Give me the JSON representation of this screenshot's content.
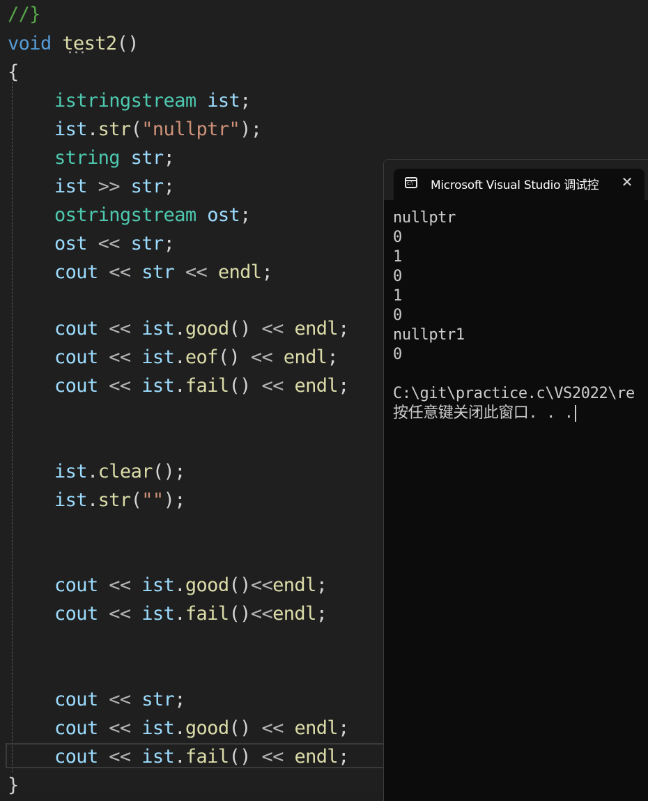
{
  "editor": {
    "lines": {
      "comment_close": "//}",
      "fn_decl_kw": "void",
      "fn_decl_name": "test2",
      "fn_decl_parens": "()",
      "open_brace": "{",
      "close_brace": "}",
      "l1_type": "istringstream",
      "l1_var": "ist",
      "l2_obj": "ist",
      "l2_fn": "str",
      "l2_str": "\"nullptr\"",
      "l3_type": "string",
      "l3_var": "str",
      "l4_a": "ist",
      "l4_op": ">>",
      "l4_b": "str",
      "l5_type": "ostringstream",
      "l5_var": "ost",
      "l6_a": "ost",
      "l6_op": "<<",
      "l6_b": "str",
      "cout": "cout",
      "endl": "endl",
      "op_out": "<<",
      "ist": "ist",
      "str": "str",
      "good": "good",
      "eof": "eof",
      "fail": "fail",
      "clear": "clear",
      "empty_str": "\"\""
    }
  },
  "console": {
    "tab_title": "Microsoft Visual Studio 调试控",
    "close_symbol": "✕",
    "icon_name": "terminal-icon",
    "output": [
      "nullptr",
      "0",
      "1",
      "0",
      "1",
      "0",
      "nullptr1",
      "0",
      "",
      "C:\\git\\practice.c\\VS2022\\re",
      "按任意键关闭此窗口. . ."
    ]
  }
}
